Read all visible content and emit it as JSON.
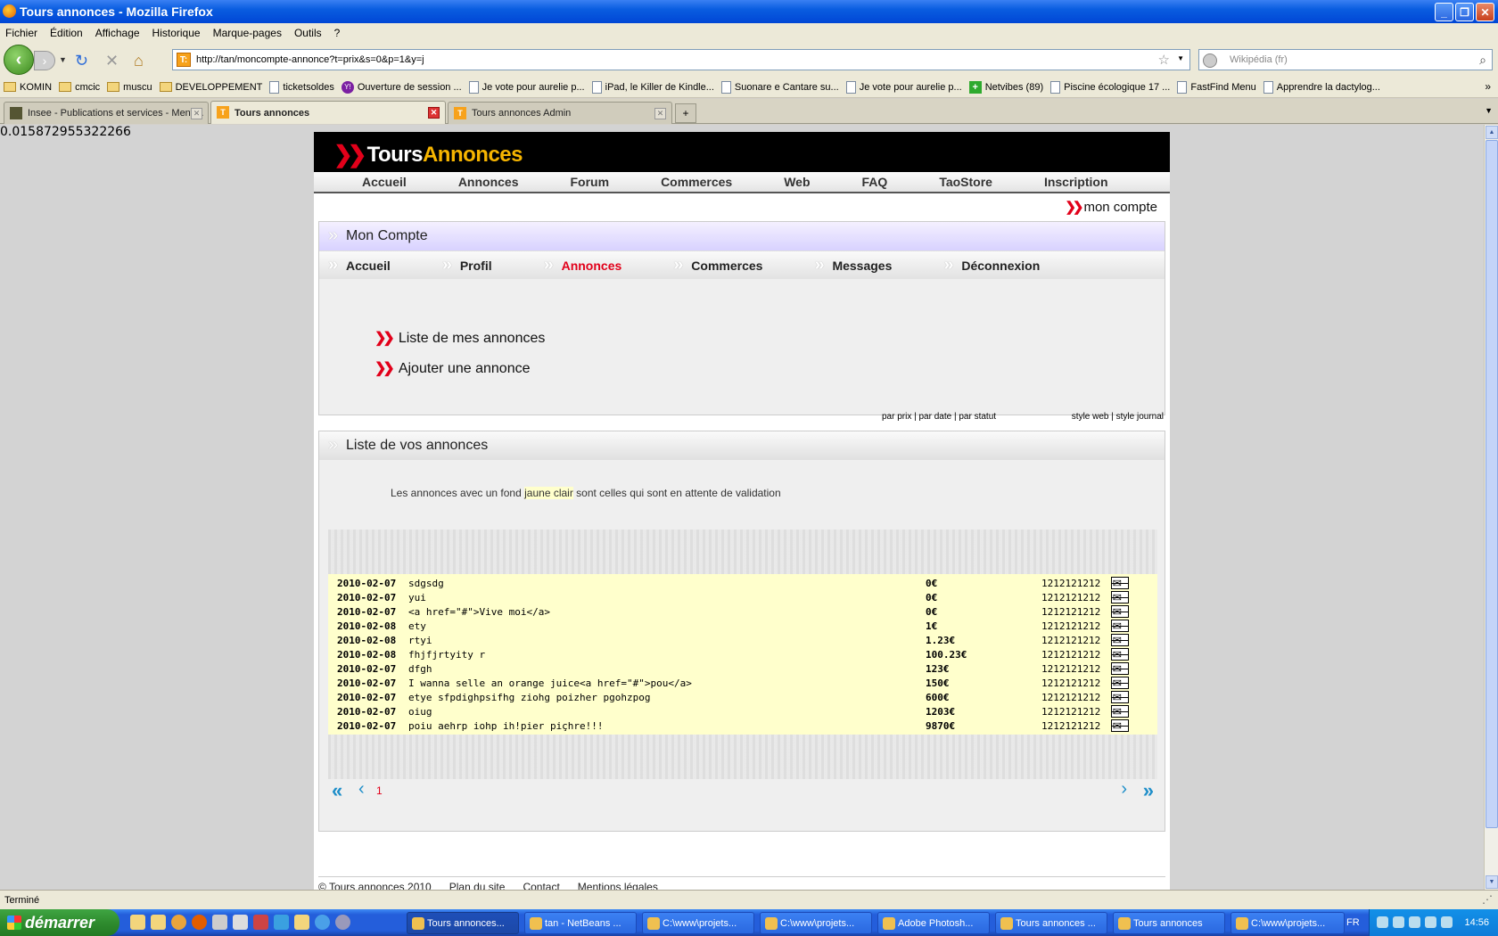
{
  "window": {
    "title": "Tours annonces - Mozilla Firefox"
  },
  "menubar": [
    "Fichier",
    "Édition",
    "Affichage",
    "Historique",
    "Marque-pages",
    "Outils",
    "?"
  ],
  "navbar": {
    "url": "http://tan/moncompte-annonce?t=prix&s=0&p=1&y=j",
    "search_placeholder": "Wikipédia (fr)",
    "favicon_text": "T:"
  },
  "bookmarks": [
    {
      "label": "KOMIN",
      "icon": "folder-icon"
    },
    {
      "label": "cmcic",
      "icon": "folder-icon"
    },
    {
      "label": "muscu",
      "icon": "folder-icon"
    },
    {
      "label": "DEVELOPPEMENT",
      "icon": "folder-icon"
    },
    {
      "label": "ticketsoldes",
      "icon": "page-icon"
    },
    {
      "label": "Ouverture de session ...",
      "icon": "yahoo-icon"
    },
    {
      "label": "Je vote pour aurelie p...",
      "icon": "page-icon"
    },
    {
      "label": "iPad, le Killer de Kindle...",
      "icon": "page-icon"
    },
    {
      "label": "Suonare e Cantare su...",
      "icon": "page-icon"
    },
    {
      "label": "Je vote pour aurelie p...",
      "icon": "page-icon"
    },
    {
      "label": "Netvibes (89)",
      "icon": "netvibes-icon"
    },
    {
      "label": "Piscine écologique 17 ...",
      "icon": "page-icon"
    },
    {
      "label": "FastFind Menu",
      "icon": "page-icon"
    },
    {
      "label": "Apprendre la dactylog...",
      "icon": "page-icon"
    }
  ],
  "tabs": [
    {
      "label": "Insee - Publications et services - Menti...",
      "active": false
    },
    {
      "label": "Tours annonces",
      "active": true
    },
    {
      "label": "Tours annonces Admin",
      "active": false
    }
  ],
  "page": {
    "debug_value": "0.015872955322266",
    "logo": {
      "part1": "Tours",
      "part2": "Annonces"
    },
    "topnav": [
      "Accueil",
      "Annonces",
      "Forum",
      "Commerces",
      "Web",
      "FAQ",
      "TaoStore",
      "Inscription"
    ],
    "account_link": "mon compte",
    "moncompte_title": "Mon Compte",
    "subnav": [
      {
        "label": "Accueil",
        "active": false
      },
      {
        "label": "Profil",
        "active": false
      },
      {
        "label": "Annonces",
        "active": true
      },
      {
        "label": "Commerces",
        "active": false
      },
      {
        "label": "Messages",
        "active": false
      },
      {
        "label": "Déconnexion",
        "active": false
      }
    ],
    "actions": [
      "Liste de mes annonces",
      "Ajouter une annonce"
    ],
    "sort_links": {
      "left": "par prix | par date | par statut",
      "right": "style web | style journal"
    },
    "list_title": "Liste de vos annonces",
    "note": {
      "before": "Les annonces avec un fond ",
      "highlight": "jaune clair",
      "after": " sont celles qui sont en attente de validation"
    },
    "annonces": [
      {
        "date": "2010-02-07",
        "title": "sdgsdg",
        "price": "0€",
        "phone": "1212121212"
      },
      {
        "date": "2010-02-07",
        "title": "yui",
        "price": "0€",
        "phone": "1212121212"
      },
      {
        "date": "2010-02-07",
        "title": "<a href=\"#\">Vive moi</a>",
        "price": "0€",
        "phone": "1212121212"
      },
      {
        "date": "2010-02-08",
        "title": "ety",
        "price": "1€",
        "phone": "1212121212"
      },
      {
        "date": "2010-02-08",
        "title": "rtyi",
        "price": "1.23€",
        "phone": "1212121212"
      },
      {
        "date": "2010-02-08",
        "title": "fhjfjrtyity r",
        "price": "100.23€",
        "phone": "1212121212"
      },
      {
        "date": "2010-02-07",
        "title": "dfgh",
        "price": "123€",
        "phone": "1212121212"
      },
      {
        "date": "2010-02-07",
        "title": "I wanna selle an orange juice<a href=\"#\">pou</a>",
        "price": "150€",
        "phone": "1212121212"
      },
      {
        "date": "2010-02-07",
        "title": "etye sfpdighpsifhg ziohg poizher pgohzpog",
        "price": "600€",
        "phone": "1212121212"
      },
      {
        "date": "2010-02-07",
        "title": "oiug",
        "price": "1203€",
        "phone": "1212121212"
      },
      {
        "date": "2010-02-07",
        "title": "poiu aehrp iohp ih!pier piçhre!!!",
        "price": "9870€",
        "phone": "1212121212"
      }
    ],
    "pager": {
      "first": "«",
      "prev": "‹",
      "current": "1",
      "next": "›",
      "last": "»"
    },
    "footer": [
      "© Tours annonces 2010",
      "Plan du site",
      "Contact",
      "Mentions légales"
    ]
  },
  "statusbar": {
    "text": "Terminé"
  },
  "taskbar": {
    "start_label": "démarrer",
    "items": [
      {
        "label": "Tours annonces...",
        "active": true
      },
      {
        "label": "tan - NetBeans ...",
        "active": false
      },
      {
        "label": "C:\\www\\projets...",
        "active": false
      },
      {
        "label": "C:\\www\\projets...",
        "active": false
      },
      {
        "label": "Adobe Photosh...",
        "active": false
      },
      {
        "label": "Tours annonces ...",
        "active": false
      },
      {
        "label": "Tours annonces",
        "active": false
      },
      {
        "label": "C:\\www\\projets...",
        "active": false
      }
    ],
    "lang": "FR",
    "clock": "14:56"
  },
  "colors": {
    "accent_red": "#e2001a",
    "logo_yellow": "#f7b500",
    "pending_yellow": "#ffffcc",
    "pager_blue": "#1e8ec9"
  }
}
